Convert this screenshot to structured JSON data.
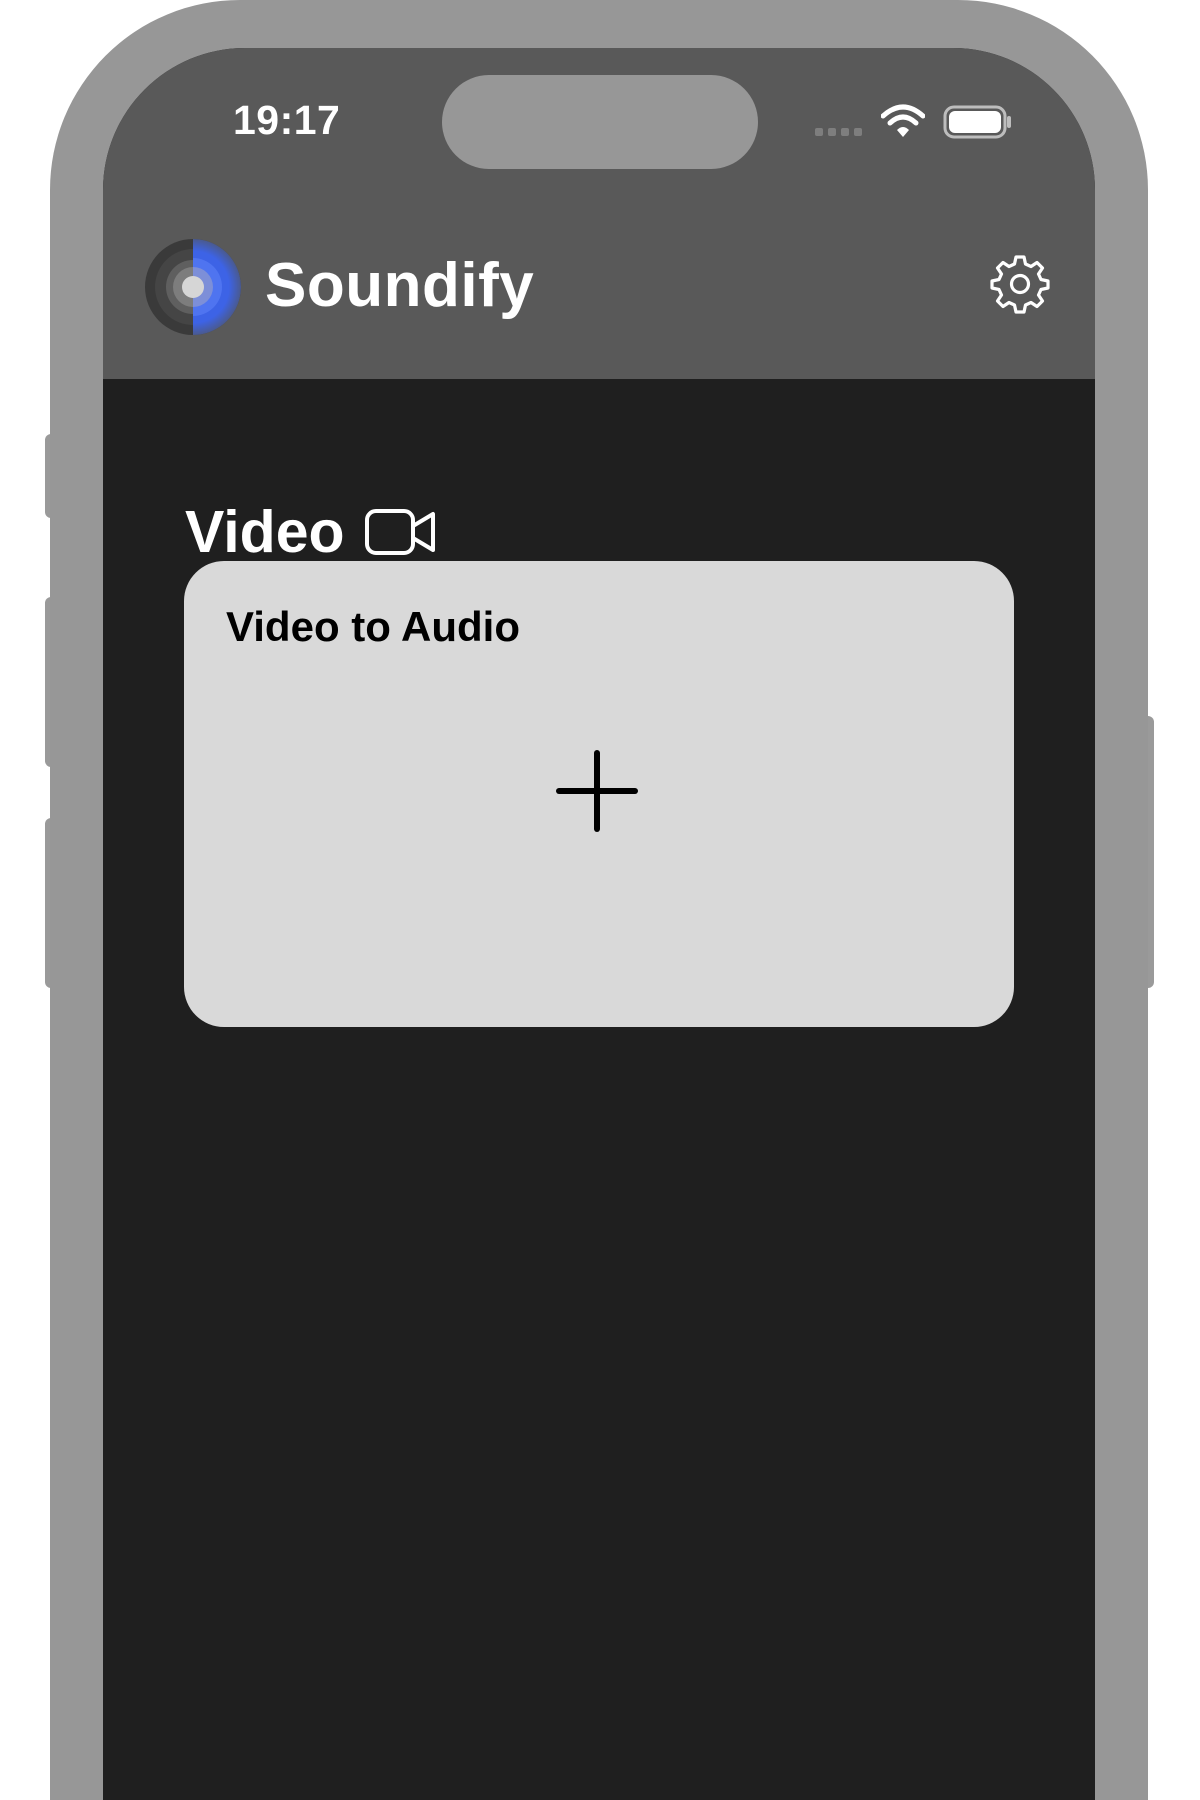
{
  "status_bar": {
    "time": "19:17",
    "signal_icon": "cellular-signal-icon",
    "wifi_icon": "wifi-icon",
    "battery_icon": "battery-icon"
  },
  "header": {
    "app_name": "Soundify",
    "logo_icon": "speaker-disc-logo",
    "settings_icon": "gear-icon"
  },
  "section": {
    "title": "Video",
    "icon": "video-camera-icon"
  },
  "card": {
    "title": "Video to Audio",
    "add_icon": "plus-icon"
  },
  "colors": {
    "device_frame": "#979797",
    "header_background": "#595959",
    "screen_background": "#1f1f1f",
    "card_background": "#d9d9d9",
    "logo_accent": "#3d63e6",
    "text_primary": "#ffffff"
  }
}
